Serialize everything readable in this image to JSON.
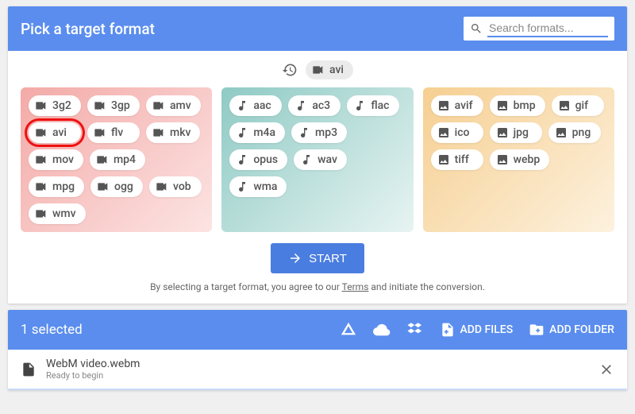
{
  "header": {
    "title": "Pick a target format",
    "search_placeholder": "Search formats..."
  },
  "recent": {
    "label": "avi"
  },
  "groups": {
    "video": [
      "3g2",
      "3gp",
      "amv",
      "avi",
      "flv",
      "mkv",
      "mov",
      "mp4",
      "mpg",
      "ogg",
      "vob",
      "wmv"
    ],
    "audio": [
      "aac",
      "ac3",
      "flac",
      "m4a",
      "mp3",
      "opus",
      "wav",
      "wma"
    ],
    "image": [
      "avif",
      "bmp",
      "gif",
      "ico",
      "jpg",
      "png",
      "tiff",
      "webp"
    ]
  },
  "highlighted_format": "avi",
  "start_button": "START",
  "disclaimer_pre": "By selecting a target format, you agree to our ",
  "disclaimer_link": "Terms",
  "disclaimer_post": " and initiate the conversion.",
  "file_bar": {
    "selected_text": "1 selected",
    "add_files": "ADD FILES",
    "add_folder": "ADD FOLDER"
  },
  "file": {
    "name": "WebM video.webm",
    "status": "Ready to begin"
  }
}
